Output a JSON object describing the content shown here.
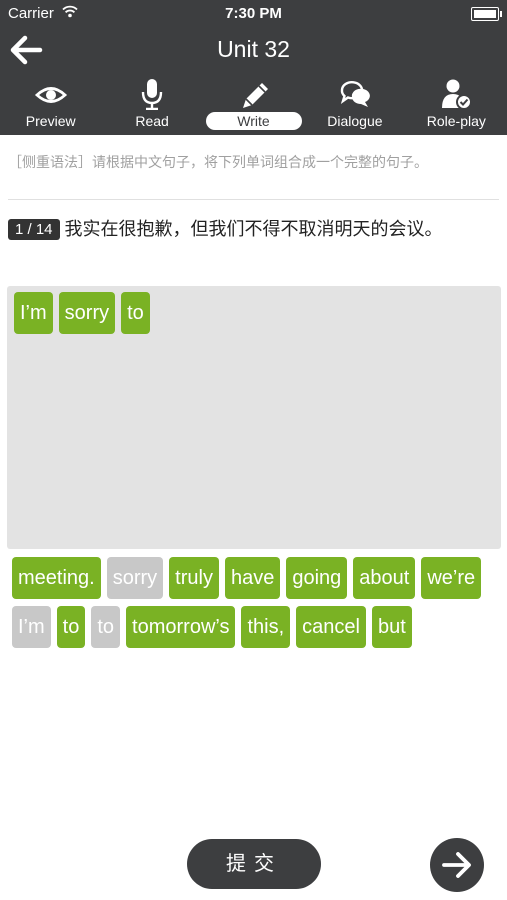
{
  "status_bar": {
    "carrier": "Carrier",
    "time": "7:30 PM"
  },
  "nav": {
    "title": "Unit 32",
    "back_icon": "back-arrow-icon"
  },
  "tabs": [
    {
      "label": "Preview",
      "icon": "eye-icon"
    },
    {
      "label": "Read",
      "icon": "microphone-icon"
    },
    {
      "label": "Write",
      "icon": "pencil-icon",
      "active": true
    },
    {
      "label": "Dialogue",
      "icon": "chat-bubbles-icon"
    },
    {
      "label": "Role-play",
      "icon": "person-check-icon"
    }
  ],
  "instruction": "［侧重语法］请根据中文句子，将下列单词组合成一个完整的句子。",
  "question": {
    "counter": "1 / 14",
    "text": "我实在很抱歉，但我们不得不取消明天的会议。"
  },
  "answer_words": [
    "I’m",
    "sorry",
    "to"
  ],
  "word_bank": [
    {
      "text": "meeting.",
      "used": false
    },
    {
      "text": "sorry",
      "used": true
    },
    {
      "text": "truly",
      "used": false
    },
    {
      "text": "have",
      "used": false
    },
    {
      "text": "going",
      "used": false
    },
    {
      "text": "about",
      "used": false
    },
    {
      "text": "we’re",
      "used": false
    },
    {
      "text": "I’m",
      "used": true
    },
    {
      "text": "to",
      "used": false
    },
    {
      "text": "to",
      "used": true
    },
    {
      "text": "tomorrow’s",
      "used": false
    },
    {
      "text": "this,",
      "used": false
    },
    {
      "text": "cancel",
      "used": false
    },
    {
      "text": "but",
      "used": false
    }
  ],
  "submit_label": "提交",
  "next_icon": "arrow-right-icon",
  "colors": {
    "header": "#3d3e40",
    "chip": "#7ab224",
    "chip_used": "#c8c8c8",
    "answer_bg": "#e3e3e3"
  }
}
